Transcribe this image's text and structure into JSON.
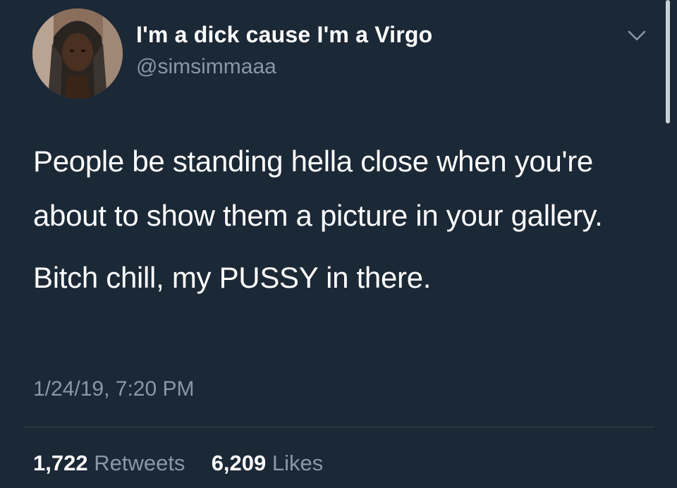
{
  "tweet": {
    "author": {
      "display_name": "I'm a dick cause I'm a Virgo",
      "handle": "@simsimmaaa"
    },
    "text": {
      "paragraph_1": "People be standing hella close when you're about to show them a picture in your gallery.",
      "paragraph_2": "Bitch chill, my PUSSY in there."
    },
    "timestamp": "1/24/19, 7:20 PM",
    "stats": {
      "retweets_count": "1,722",
      "retweets_label": "Retweets",
      "likes_count": "6,209",
      "likes_label": "Likes"
    }
  },
  "icons": {
    "menu": "chevron-down-icon"
  },
  "colors": {
    "background": "#1b2836",
    "primary_text": "#ffffff",
    "secondary_text": "#8899a6",
    "divider": "#38444d"
  }
}
